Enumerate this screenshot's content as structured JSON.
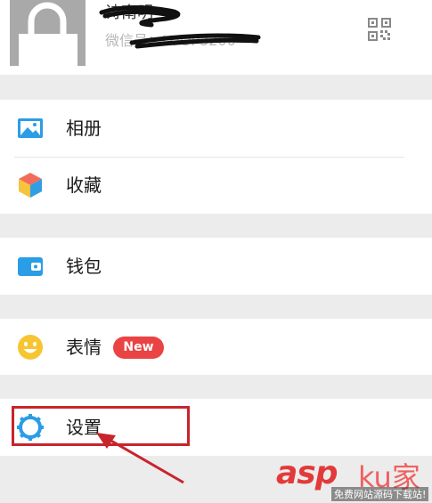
{
  "profile": {
    "name": "诗南明",
    "wechat_id_label": "微信号：LUOP3200",
    "avatar_icon": "lock-icon",
    "qr_icon": "qr-code-icon"
  },
  "menu": {
    "album": {
      "label": "相册",
      "icon": "image-icon"
    },
    "favorites": {
      "label": "收藏",
      "icon": "cube-icon"
    },
    "wallet": {
      "label": "钱包",
      "icon": "wallet-icon"
    },
    "stickers": {
      "label": "表情",
      "icon": "smiley-icon",
      "badge": "New"
    },
    "settings": {
      "label": "设置",
      "icon": "gear-icon"
    }
  },
  "watermark": {
    "brand": "asp",
    "brand_suffix": "ku家",
    "tagline": "免费网站源码下载站!"
  },
  "colors": {
    "accent_blue": "#2a9de6",
    "badge_red": "#e94343",
    "annotation_red": "#c8242b",
    "section_gap": "#ececec"
  }
}
